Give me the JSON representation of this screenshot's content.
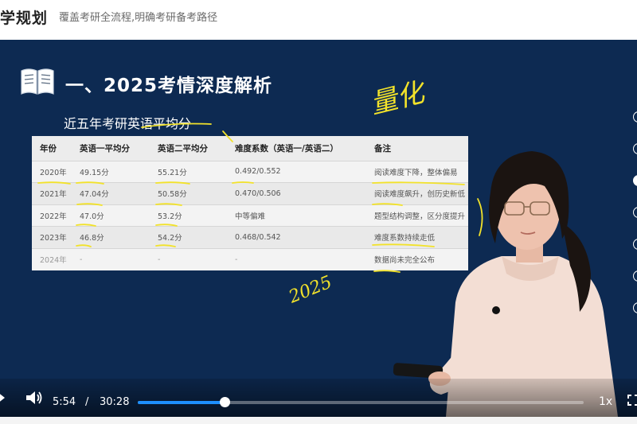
{
  "header": {
    "title": "学规划",
    "subtitle": "覆盖考研全流程,明确考研备考路径"
  },
  "slide": {
    "title": "一、2025考情深度解析",
    "table_caption": "近五年考研英语平均分",
    "columns": [
      "年份",
      "英语一平均分",
      "英语二平均分",
      "难度系数（英语一/英语二）",
      "备注"
    ],
    "rows": [
      [
        "2020年",
        "49.15分",
        "55.21分",
        "0.492/0.552",
        "阅读难度下降，整体偏易"
      ],
      [
        "2021年",
        "47.04分",
        "50.58分",
        "0.470/0.506",
        "阅读难度飙升，创历史新低"
      ],
      [
        "2022年",
        "47.0分",
        "53.2分",
        "中等偏难",
        "题型结构调整，区分度提升"
      ],
      [
        "2023年",
        "46.8分",
        "54.2分",
        "0.468/0.542",
        "难度系数持续走低"
      ],
      [
        "2024年",
        "-",
        "-",
        "-",
        "数据尚未完全公布"
      ]
    ]
  },
  "annotations": {
    "quantify": "量化",
    "year_note": "2025"
  },
  "player": {
    "current_time": "5:54",
    "separator": "/",
    "total_time": "30:28",
    "progress_fraction": 0.194,
    "speed": "1x"
  },
  "icons": [
    "book-icon",
    "play-icon",
    "volume-icon",
    "fullscreen-icon"
  ],
  "colors": {
    "stage_bg": "#0d2a52",
    "progress": "#1e90ff",
    "annotation": "#f2e22a"
  }
}
